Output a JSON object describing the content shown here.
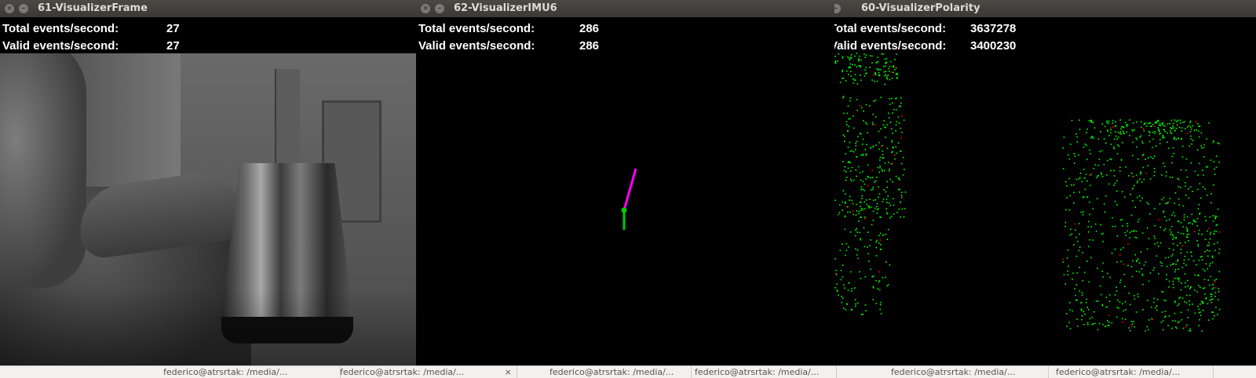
{
  "windows": {
    "frame": {
      "title": "61-VisualizerFrame",
      "total_label": "Total events/second:",
      "total_value": "27",
      "valid_label": "Valid events/second:",
      "valid_value": "27"
    },
    "imu": {
      "title": "62-VisualizerIMU6",
      "total_label": "Total events/second:",
      "total_value": "286",
      "valid_label": "Valid events/second:",
      "valid_value": "286"
    },
    "polarity": {
      "title": "60-VisualizerPolarity",
      "total_label": "Total events/second:",
      "total_value": "3637278",
      "valid_label": "Valid events/second:",
      "valid_value": "3400230"
    }
  },
  "colors": {
    "accelerometer": "#ff00ff",
    "gyroscope": "#00cc00",
    "polarity_on": "#00ff00",
    "polarity_off": "#ff0000"
  },
  "taskbar": {
    "items": [
      "federico@atrsrtak: /media/...",
      "federico@atrsrtak: /media/...",
      "federico@atrsrtak: /media/...",
      "federico@atrsrtak: /media/...",
      "federico@atrsrtak: /media/...",
      "federico@atrsrtak: /media/..."
    ],
    "close_glyph": "×"
  }
}
